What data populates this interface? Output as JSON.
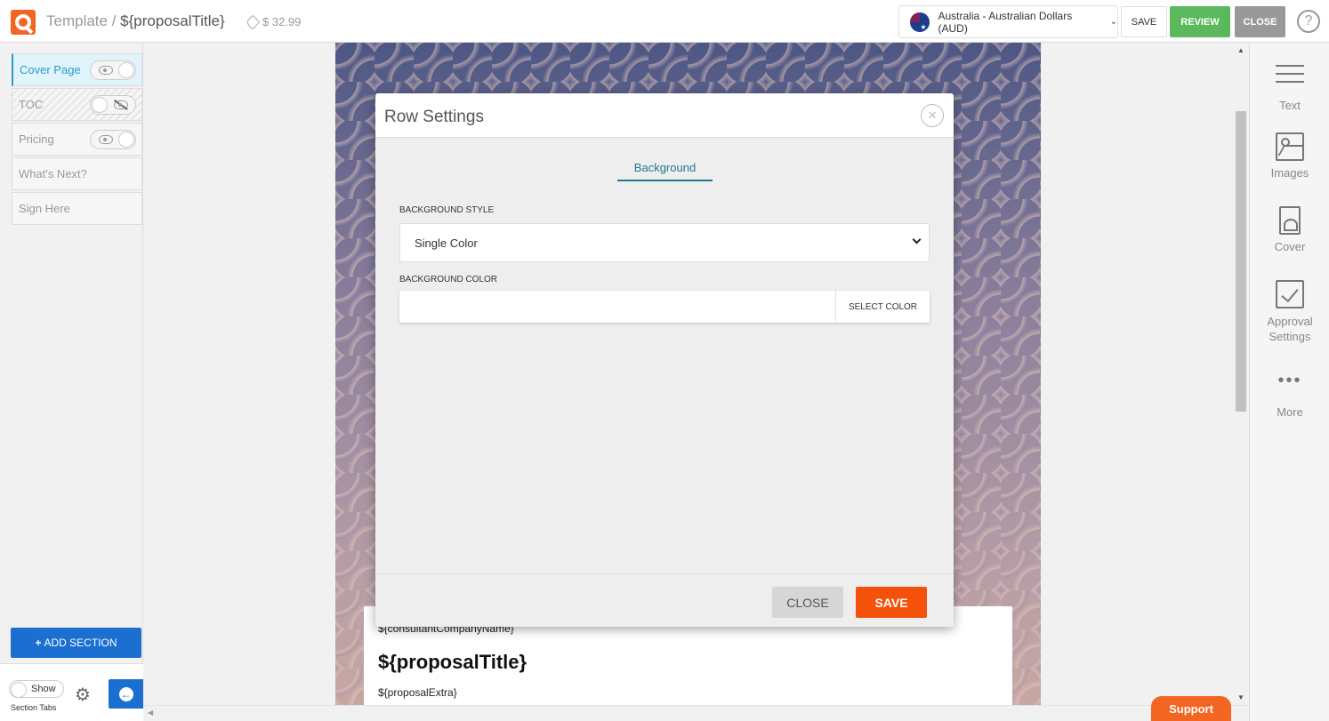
{
  "topbar": {
    "breadcrumb_root": "Template",
    "breadcrumb_sep": " / ",
    "proposal_title": "${proposalTitle}",
    "price": "$ 32.99",
    "currency": "Australia - Australian Dollars (AUD)",
    "save_label": "SAVE",
    "review_label": "REVIEW",
    "close_label": "CLOSE",
    "help_label": "?"
  },
  "sidebar": {
    "sections": [
      {
        "label": "Cover Page",
        "active": true,
        "visible": true
      },
      {
        "label": "TOC",
        "visible": false
      },
      {
        "label": "Pricing",
        "visible": true
      },
      {
        "label": "What's Next?"
      },
      {
        "label": "Sign Here"
      }
    ],
    "add_section_label": "ADD SECTION",
    "show_label": "Show",
    "section_tabs_label": "Section Tabs"
  },
  "page": {
    "company": "${consultantCompanyName}",
    "title": "${proposalTitle}",
    "extra": "${proposalExtra}"
  },
  "tools": [
    {
      "label": "Text",
      "icon": "text-icon"
    },
    {
      "label": "Images",
      "icon": "image-icon"
    },
    {
      "label": "Cover",
      "icon": "cover-icon"
    },
    {
      "label": "Approval Settings",
      "icon": "checkbox-icon"
    },
    {
      "label": "More",
      "icon": "more-icon"
    }
  ],
  "modal": {
    "title": "Row Settings",
    "tab": "Background",
    "bg_style_label": "BACKGROUND STYLE",
    "bg_style_value": "Single Color",
    "bg_color_label": "BACKGROUND COLOR",
    "bg_color_value": "",
    "select_color_label": "SELECT COLOR",
    "close_label": "CLOSE",
    "save_label": "SAVE"
  },
  "support_label": "Support",
  "colors": {
    "brand": "#f26522",
    "review": "#5cb85c",
    "primary_blue": "#1a6fd1",
    "save_orange": "#f4510b",
    "tab_teal": "#1e7b8c"
  }
}
